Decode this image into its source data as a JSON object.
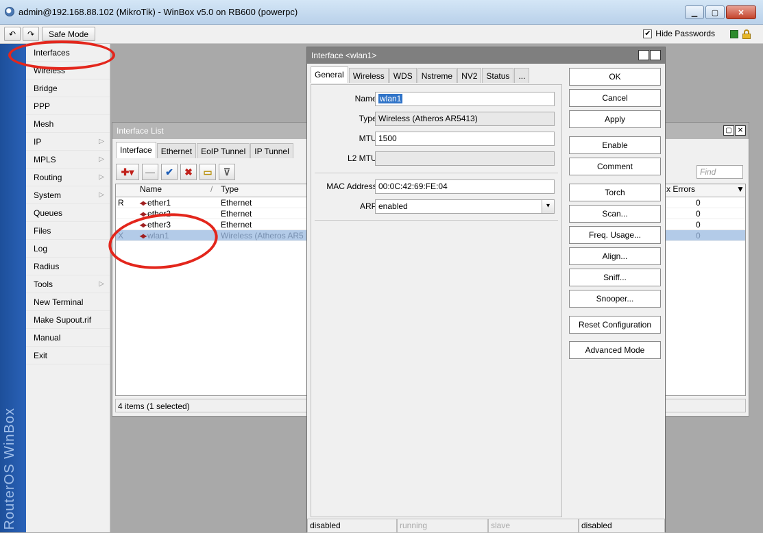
{
  "window": {
    "title": "admin@192.168.88.102 (MikroTik) - WinBox v5.0 on RB600 (powerpc)",
    "min": "▁",
    "max": "▢",
    "close": "✕"
  },
  "toolbar": {
    "undo": "↶",
    "redo": "↷",
    "safe_mode": "Safe Mode",
    "hide_passwords_check": "✔",
    "hide_passwords": "Hide Passwords"
  },
  "brand": "RouterOS WinBox",
  "menu": [
    {
      "label": "Interfaces",
      "sub": false
    },
    {
      "label": "Wireless",
      "sub": false
    },
    {
      "label": "Bridge",
      "sub": false
    },
    {
      "label": "PPP",
      "sub": false
    },
    {
      "label": "Mesh",
      "sub": false
    },
    {
      "label": "IP",
      "sub": true
    },
    {
      "label": "MPLS",
      "sub": true
    },
    {
      "label": "Routing",
      "sub": true
    },
    {
      "label": "System",
      "sub": true
    },
    {
      "label": "Queues",
      "sub": false
    },
    {
      "label": "Files",
      "sub": false
    },
    {
      "label": "Log",
      "sub": false
    },
    {
      "label": "Radius",
      "sub": false
    },
    {
      "label": "Tools",
      "sub": true
    },
    {
      "label": "New Terminal",
      "sub": false
    },
    {
      "label": "Make Supout.rif",
      "sub": false
    },
    {
      "label": "Manual",
      "sub": false
    },
    {
      "label": "Exit",
      "sub": false
    }
  ],
  "menu_arrow": "▷",
  "iflist": {
    "title": "Interface List",
    "restore": "▢",
    "close": "✕",
    "tabs": [
      "Interface",
      "Ethernet",
      "EoIP Tunnel",
      "IP Tunnel"
    ],
    "toolbar": {
      "add": "✚▾",
      "remove": "—",
      "enable": "✔",
      "disable": "✖",
      "comment": "▭",
      "filter": "⊽"
    },
    "find_placeholder": "Find",
    "columns": {
      "name": "Name",
      "sort": "/",
      "type": "Type",
      "rx_errors": "x Errors",
      "menu": "▼"
    },
    "rows": [
      {
        "flag": "R",
        "name": "ether1",
        "type": "Ethernet",
        "rx_errors": "0",
        "selected": false
      },
      {
        "flag": "",
        "name": "ether2",
        "type": "Ethernet",
        "rx_errors": "0",
        "selected": false
      },
      {
        "flag": "",
        "name": "ether3",
        "type": "Ethernet",
        "rx_errors": "0",
        "selected": false
      },
      {
        "flag": "X",
        "name": "wlan1",
        "type": "Wireless (Atheros AR5",
        "rx_errors": "0",
        "selected": true
      }
    ],
    "row_icon": "◂▸",
    "status": "4 items (1 selected)"
  },
  "dialog": {
    "title": "Interface <wlan1>",
    "restore": "▢",
    "close": "✕",
    "tabs": [
      "General",
      "Wireless",
      "WDS",
      "Nstreme",
      "NV2",
      "Status",
      "..."
    ],
    "fields": {
      "name_label": "Name:",
      "name": "wlan1",
      "type_label": "Type:",
      "type": "Wireless (Atheros AR5413)",
      "mtu_label": "MTU:",
      "mtu": "1500",
      "l2mtu_label": "L2 MTU:",
      "l2mtu": "",
      "mac_label": "MAC Address:",
      "mac": "00:0C:42:69:FE:04",
      "arp_label": "ARP:",
      "arp": "enabled",
      "arp_arrow": "▾"
    },
    "buttons": [
      "OK",
      "Cancel",
      "Apply",
      "Enable",
      "Comment",
      "Torch",
      "Scan...",
      "Freq. Usage...",
      "Align...",
      "Sniff...",
      "Snooper...",
      "Reset Configuration",
      "Advanced Mode"
    ],
    "status": [
      "disabled",
      "running",
      "slave",
      "disabled"
    ]
  },
  "colors": {
    "annotation": "#e3261c",
    "brand": "#2a62b8",
    "selection": "#b3cbe8"
  }
}
